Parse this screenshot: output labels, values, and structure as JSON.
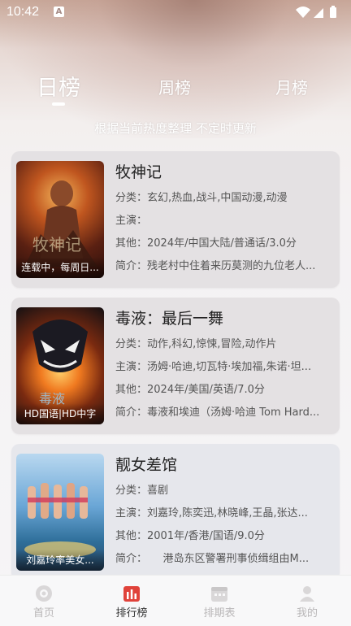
{
  "status_bar": {
    "time": "10:42",
    "notification_letter": "A"
  },
  "tabs": [
    {
      "label": "日榜",
      "active": true
    },
    {
      "label": "周榜",
      "active": false
    },
    {
      "label": "月榜",
      "active": false
    }
  ],
  "subtitle": "根据当前热度整理 不定时更新",
  "items": [
    {
      "title": "牧神记",
      "badge": "连载中，每周日...",
      "category_label": "分类：",
      "category": "玄幻,热血,战斗,中国动漫,动漫",
      "cast_label": "主演：",
      "cast": "",
      "other_label": "其他：",
      "other": "2024年/中国大陆/普通话/3.0分",
      "intro_label": "简介：",
      "intro": "残老村中住着来历莫测的九位老人..."
    },
    {
      "title": "毒液：最后一舞",
      "badge": "HD国语|HD中字",
      "category_label": "分类：",
      "category": "动作,科幻,惊悚,冒险,动作片",
      "cast_label": "主演：",
      "cast": "汤姆·哈迪,切瓦特·埃加福,朱诺·坦...",
      "other_label": "其他：",
      "other": "2024年/美国/英语/7.0分",
      "intro_label": "简介：",
      "intro": "毒液和埃迪（汤姆·哈迪 Tom Hard..."
    },
    {
      "title": "靓女差馆",
      "badge": "刘嘉玲率美女...",
      "category_label": "分类：",
      "category": "喜剧",
      "cast_label": "主演：",
      "cast": "刘嘉玲,陈奕迅,林晓峰,王晶,张达...",
      "other_label": "其他：",
      "other": "2001年/香港/国语/9.0分",
      "intro_label": "简介：",
      "intro": "　　港岛东区警署刑事侦缉组由M..."
    }
  ],
  "bottom_nav": [
    {
      "label": "首页",
      "icon": "home-icon",
      "active": false
    },
    {
      "label": "排行榜",
      "icon": "ranking-icon",
      "active": true
    },
    {
      "label": "排期表",
      "icon": "calendar-icon",
      "active": false
    },
    {
      "label": "我的",
      "icon": "profile-icon",
      "active": false
    }
  ],
  "colors": {
    "accent": "#e0423a",
    "card_bg": "#e4e1e3",
    "inactive_nav": "#b9b7b8"
  }
}
